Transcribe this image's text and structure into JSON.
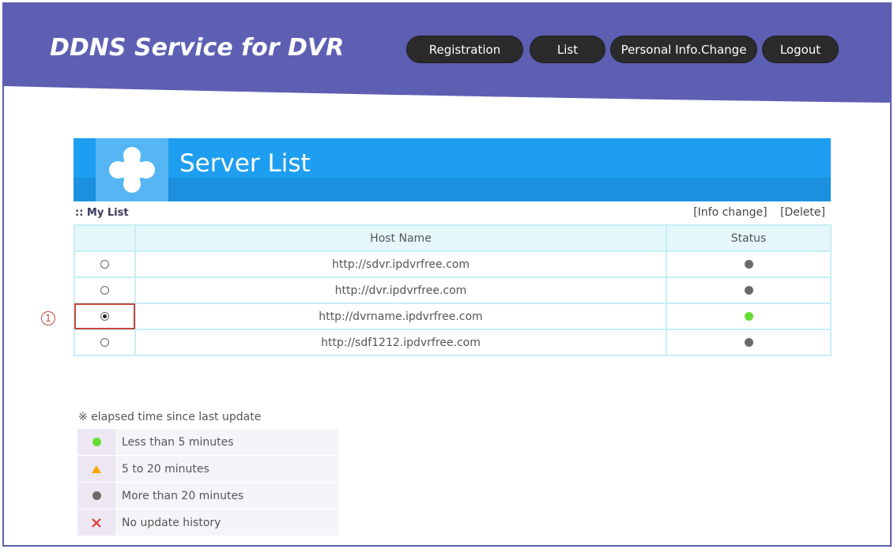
{
  "app": {
    "title": "DDNS Service for DVR"
  },
  "nav": {
    "items": [
      {
        "label": "Registration"
      },
      {
        "label": "List"
      },
      {
        "label": "Personal Info.Change"
      },
      {
        "label": "Logout"
      }
    ]
  },
  "banner": {
    "title": "Server List"
  },
  "list": {
    "label": ":: My List",
    "actions": [
      "[Info change]",
      "[Delete]"
    ],
    "columns": [
      "Host Name",
      "Status"
    ],
    "rows": [
      {
        "host": "http://sdvr.ipdvrfree.com",
        "status": "gray",
        "selected": false
      },
      {
        "host": "http://dvr.ipdvrfree.com",
        "status": "gray",
        "selected": false
      },
      {
        "host": "http://dvrname.ipdvrfree.com",
        "status": "green",
        "selected": true
      },
      {
        "host": "http://sdf1212.ipdvrfree.com",
        "status": "gray",
        "selected": false
      }
    ]
  },
  "marker": {
    "label": "1"
  },
  "legend": {
    "note": "※ elapsed time since last update",
    "items": [
      {
        "symbol": "green-dot",
        "label": "Less than 5 minutes"
      },
      {
        "symbol": "orange-triangle",
        "label": "5 to 20 minutes"
      },
      {
        "symbol": "gray-dot",
        "label": "More than 20 minutes"
      },
      {
        "symbol": "red-x",
        "label": "No update history"
      }
    ]
  },
  "colors": {
    "header": "#5d5fb3",
    "banner": "#1e9ef0",
    "nav_button": "#2b2b2b",
    "status_green": "#66dd33",
    "status_gray": "#6a6a6a",
    "status_orange": "#f6a800",
    "status_red": "#e03030"
  }
}
